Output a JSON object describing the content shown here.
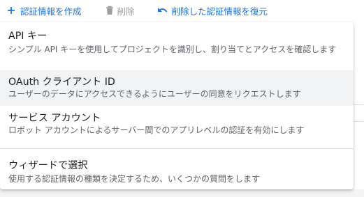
{
  "toolbar": {
    "create_label": "認証情報を作成",
    "delete_label": "削除",
    "restore_label": "削除した認証情報を復元",
    "accent_color": "#1a73e8",
    "disabled_color": "#9aa0a6"
  },
  "menu": {
    "items": [
      {
        "title": "API キー",
        "description": "シンプル API キーを使用してプロジェクトを識別し、割り当てとアクセスを確認します"
      },
      {
        "title": "OAuth クライアント ID",
        "description": "ユーザーのデータにアクセスできるようにユーザーの同意をリクエストします"
      },
      {
        "title": "サービス アカウント",
        "description": "ロボット アカウントによるサーバー間でのアプリレベルの認証を有効にします"
      },
      {
        "title": "ウィザードで選択",
        "description": "使用する認証情報の種類を決定するため、いくつかの質問をします"
      }
    ],
    "highlighted_item": "OAuth クライアント ID"
  }
}
